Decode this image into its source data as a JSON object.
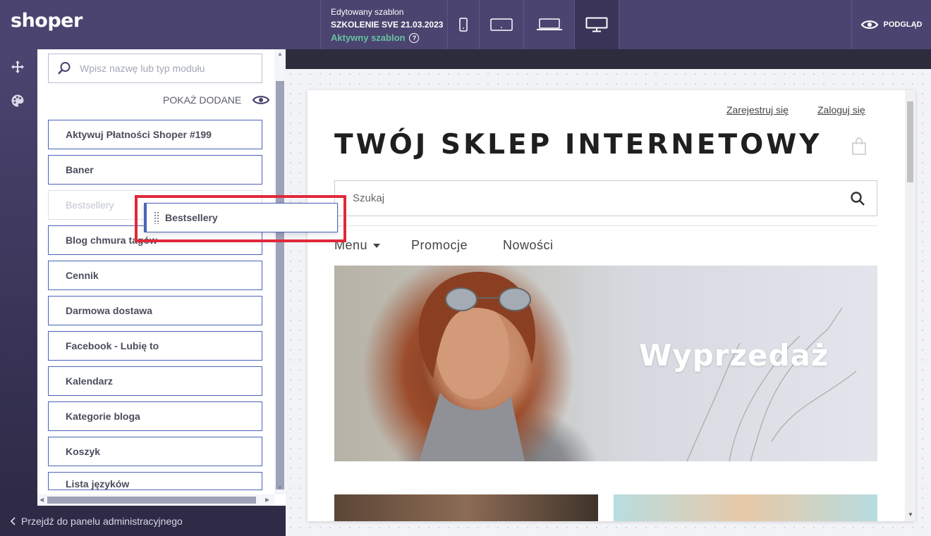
{
  "app": {
    "logo": "shoper"
  },
  "header": {
    "edited_template_label": "Edytowany szablon",
    "template_name": "SZKOLENIE SVE 21.03.2023",
    "template_status": "Aktywny szablon",
    "help_glyph": "?",
    "preview_label": "PODGLĄD",
    "devices": [
      "mobile-icon",
      "tablet-icon",
      "laptop-icon",
      "desktop-icon"
    ],
    "active_device": "desktop"
  },
  "sidebar": {
    "search_placeholder": "Wpisz nazwę lub typ modułu",
    "show_added_label": "POKAŻ DODANE",
    "modules": [
      "Aktywuj Płatności Shoper #199",
      "Baner",
      "Bestsellery",
      "Blog chmura tagów",
      "Cennik",
      "Darmowa dostawa",
      "Facebook - Lubię to",
      "Kalendarz",
      "Kategorie bloga",
      "Koszyk",
      "Lista języków"
    ],
    "dragging_module": "Bestsellery",
    "back_label": "Przejdź do panelu administracyjnego"
  },
  "shop": {
    "register_link": "Zarejestruj się",
    "login_link": "Zaloguj się",
    "title": "TWÓJ SKLEP INTERNETOWY",
    "search_placeholder": "Szukaj",
    "nav": [
      "Menu",
      "Promocje",
      "Nowości"
    ],
    "banner_text": "Wyprzedaż"
  },
  "colors": {
    "topbar": "#4b4470",
    "accent_green": "#67c2a0",
    "module_border": "#4a64b8",
    "highlight_red": "#e0293a"
  }
}
